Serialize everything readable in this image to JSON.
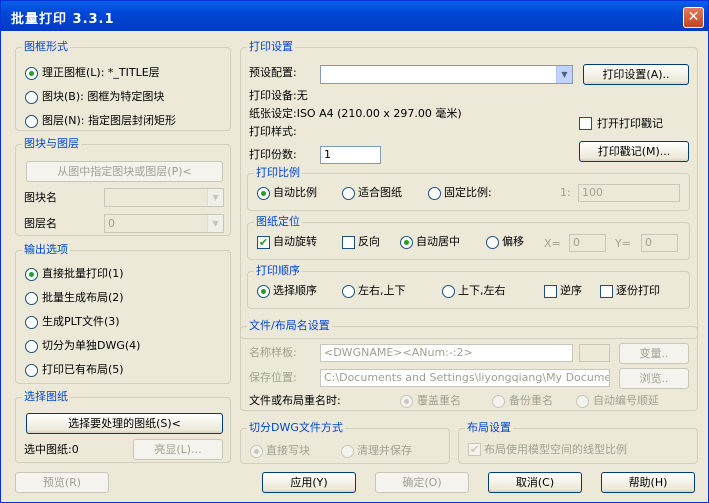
{
  "window": {
    "title": "批量打印 3.3.1",
    "close_icon": "close-icon"
  },
  "frame_format": {
    "legend": "图框形式",
    "options": [
      {
        "label": "理正图框(L): *_TITLE层",
        "selected": true
      },
      {
        "label": "图块(B): 图框为特定图块",
        "selected": false
      },
      {
        "label": "图层(N): 指定图层封闭矩形",
        "selected": false
      }
    ]
  },
  "block_layer": {
    "legend": "图块与图层",
    "pick_button": "从图中指定图块或图层(P)<",
    "block_name_label": "图块名",
    "block_name_value": "",
    "layer_name_label": "图层名",
    "layer_name_value": "0"
  },
  "output": {
    "legend": "输出选项",
    "options": [
      {
        "label": "直接批量打印(1)",
        "selected": true
      },
      {
        "label": "批量生成布局(2)",
        "selected": false
      },
      {
        "label": "生成PLT文件(3)",
        "selected": false
      },
      {
        "label": "切分为单独DWG(4)",
        "selected": false
      },
      {
        "label": "打印已有布局(5)",
        "selected": false
      }
    ]
  },
  "select_drawings": {
    "legend": "选择图纸",
    "select_button": "选择要处理的图纸(S)<",
    "selected_count": "选中图纸:0",
    "highlight_button": "亮显(L)..."
  },
  "print_settings": {
    "legend": "打印设置",
    "preset_label": "预设配置:",
    "preset_value": "",
    "settings_button": "打印设置(A)..",
    "device": "打印设备:无",
    "paper": "纸张设定:ISO A4 (210.00 x 297.00 毫米)",
    "style": "打印样式:",
    "stamp_checkbox": "打开打印戳记",
    "stamp_checked": false,
    "copies_label": "打印份数:",
    "copies_value": "1",
    "stamp_button": "打印戳记(M)..."
  },
  "scale": {
    "legend": "打印比例",
    "options": [
      {
        "label": "自动比例",
        "selected": true
      },
      {
        "label": "适合图纸",
        "selected": false
      },
      {
        "label": "固定比例:",
        "selected": false
      }
    ],
    "ratio_prefix": "1:",
    "ratio_value": "100"
  },
  "position": {
    "legend": "图纸定位",
    "auto_rotate": "自动旋转",
    "auto_rotate_checked": true,
    "reverse": "反向",
    "reverse_checked": false,
    "center": "自动居中",
    "center_selected": true,
    "offset": "偏移",
    "offset_selected": false,
    "x_label": "X=",
    "x_value": "0",
    "y_label": "Y=",
    "y_value": "0"
  },
  "order": {
    "legend": "打印顺序",
    "options": [
      {
        "label": "选择顺序",
        "selected": true
      },
      {
        "label": "左右,上下",
        "selected": false
      },
      {
        "label": "上下,左右",
        "selected": false
      }
    ],
    "reverse_order": "逆序",
    "copy_by_copy": "逐份打印"
  },
  "file_layout": {
    "legend": "文件/布局名设置",
    "name_template_label": "名称样板:",
    "name_template_value": "<DWGNAME><ANum:-:2>",
    "variable_button": "变量..",
    "save_location_label": "保存位置:",
    "save_location_value": "C:\\Documents and Settings\\liyongqiang\\My Documen",
    "browse_button": "浏览..",
    "rename_label": "文件或布局重名时:",
    "rename_options": [
      {
        "label": "覆盖重名",
        "selected": true
      },
      {
        "label": "备份重名",
        "selected": false
      },
      {
        "label": "自动编号顺延",
        "selected": false
      }
    ]
  },
  "split_dwg": {
    "legend": "切分DWG文件方式",
    "options": [
      {
        "label": "直接写块",
        "selected": true
      },
      {
        "label": "清理并保存",
        "selected": false
      }
    ]
  },
  "layout_settings": {
    "legend": "布局设置",
    "linetype_scale": "布局使用模型空间的线型比例",
    "linetype_checked": true
  },
  "footer": {
    "preview": "预览(R)",
    "apply": "应用(Y)",
    "ok": "确定(O)",
    "cancel": "取消(C)",
    "help": "帮助(H)"
  }
}
